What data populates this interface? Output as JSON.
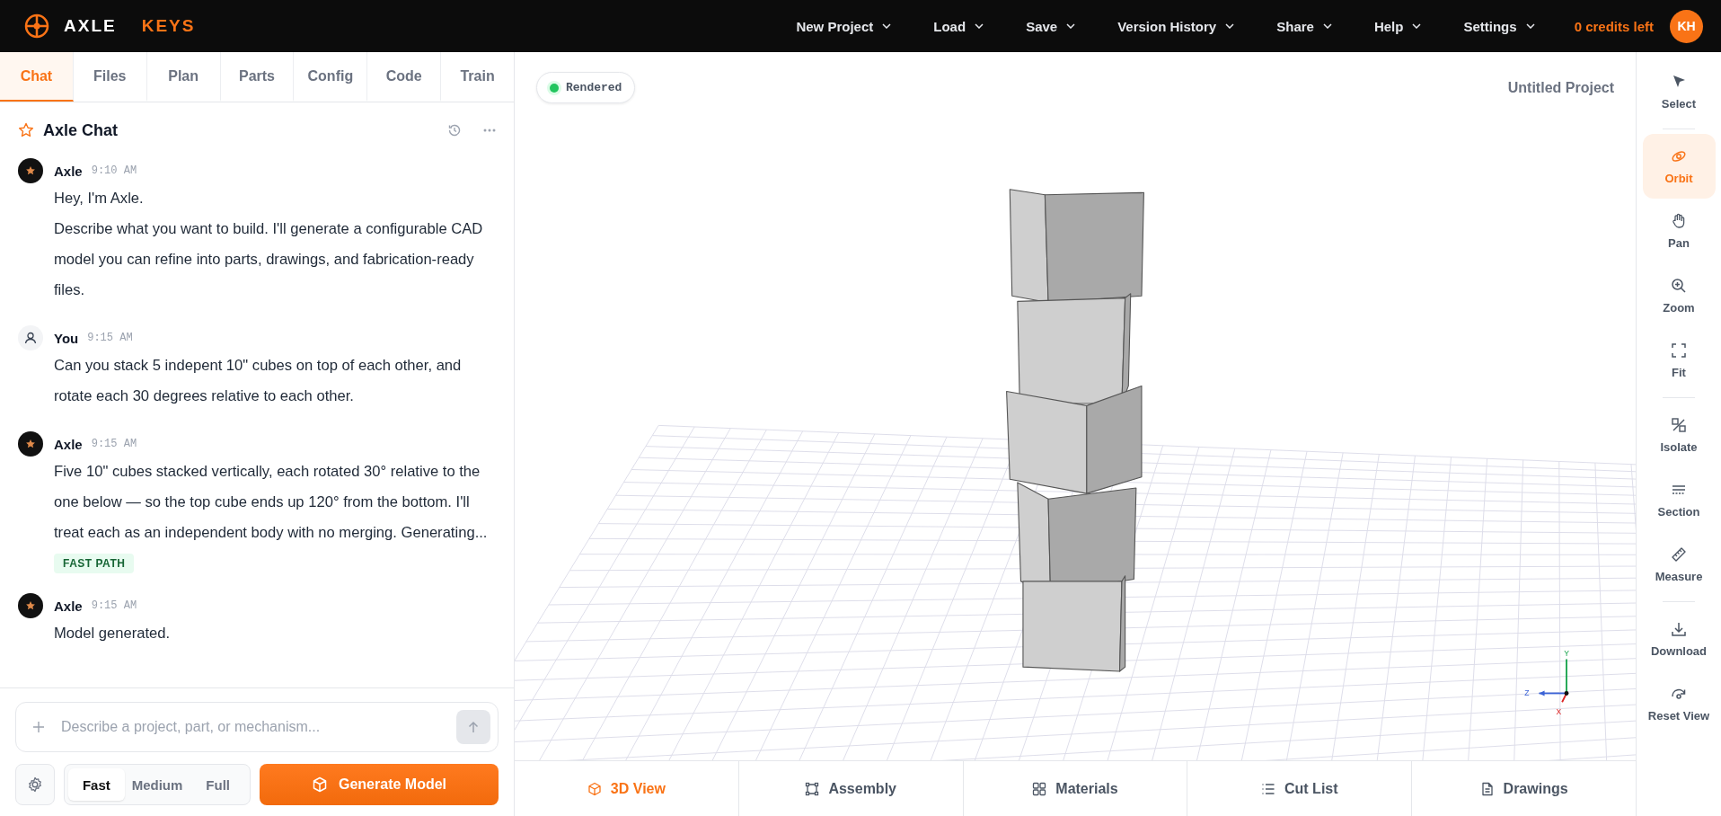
{
  "header": {
    "brand": [
      "AXLE",
      "KEYS"
    ],
    "menus": [
      {
        "label": "New Project"
      },
      {
        "label": "Load"
      },
      {
        "label": "Save"
      },
      {
        "label": "Version History"
      },
      {
        "label": "Share"
      },
      {
        "label": "Help"
      },
      {
        "label": "Settings"
      }
    ],
    "credits": "0 credits left",
    "avatar": "KH"
  },
  "panel_tabs": [
    {
      "label": "Chat",
      "selected": true
    },
    {
      "label": "Files",
      "selected": false
    },
    {
      "label": "Plan",
      "selected": false
    },
    {
      "label": "Parts",
      "selected": false
    },
    {
      "label": "Config",
      "selected": false
    },
    {
      "label": "Code",
      "selected": false
    },
    {
      "label": "Train",
      "selected": false
    }
  ],
  "chat": {
    "title": "Axle Chat",
    "messages": [
      {
        "kind": "assistant",
        "author": "Axle",
        "time": "9:10 AM",
        "paragraphs": [
          "Hey, I'm Axle.",
          "Describe what you want to build. I'll generate a configurable CAD model you can refine into parts, drawings, and fabrication-ready files."
        ]
      },
      {
        "kind": "user",
        "author": "You",
        "time": "9:15 AM",
        "paragraphs": [
          "Can you stack 5 indepent 10\" cubes on top of each other, and rotate each 30 degrees relative to each other."
        ]
      },
      {
        "kind": "assistant",
        "author": "Axle",
        "time": "9:15 AM",
        "paragraphs": [
          "Five 10\" cubes stacked vertically, each rotated 30° relative to the one below — so the top cube ends up 120° from the bottom. I'll treat each as an independent body with no merging. Generating..."
        ],
        "badge": "FAST PATH"
      },
      {
        "kind": "assistant",
        "author": "Axle",
        "time": "9:15 AM",
        "paragraphs": [
          "Model generated."
        ]
      }
    ]
  },
  "composer": {
    "placeholder": "Describe a project, part, or mechanism...",
    "modes": [
      {
        "label": "Fast",
        "selected": true
      },
      {
        "label": "Medium",
        "selected": false
      },
      {
        "label": "Full",
        "selected": false
      }
    ],
    "generate": "Generate Model"
  },
  "viewport": {
    "status": "Rendered",
    "project": "Untitled Project",
    "axes": [
      {
        "kind": "y",
        "label": "Y"
      },
      {
        "kind": "z",
        "label": "Z"
      },
      {
        "kind": "x",
        "label": "X"
      }
    ]
  },
  "tool_groups": [
    [
      {
        "kind": "select",
        "label": "Select",
        "selected": false
      }
    ],
    [
      {
        "kind": "orbit",
        "label": "Orbit",
        "selected": true
      },
      {
        "kind": "pan",
        "label": "Pan",
        "selected": false
      },
      {
        "kind": "zoom",
        "label": "Zoom",
        "selected": false
      },
      {
        "kind": "fit",
        "label": "Fit",
        "selected": false
      }
    ],
    [
      {
        "kind": "isolate",
        "label": "Isolate",
        "selected": false
      },
      {
        "kind": "section",
        "label": "Section",
        "selected": false
      },
      {
        "kind": "measure",
        "label": "Measure",
        "selected": false
      }
    ],
    [
      {
        "kind": "download",
        "label": "Download",
        "selected": false
      },
      {
        "kind": "reset",
        "label": "Reset View",
        "selected": false
      }
    ]
  ],
  "view_tabs": [
    {
      "kind": "cube",
      "label": "3D View",
      "selected": true
    },
    {
      "kind": "assembly",
      "label": "Assembly",
      "selected": false
    },
    {
      "kind": "materials",
      "label": "Materials",
      "selected": false
    },
    {
      "kind": "list",
      "label": "Cut List",
      "selected": false
    },
    {
      "kind": "doc",
      "label": "Drawings",
      "selected": false
    }
  ]
}
